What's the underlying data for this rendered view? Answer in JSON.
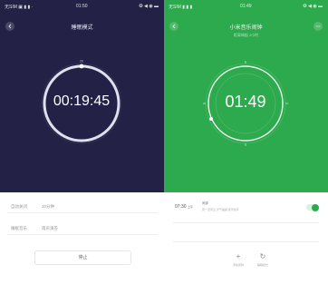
{
  "left": {
    "status": {
      "carrier": "无SIM ▣ ▮ ▮ ·",
      "time": "01:50",
      "icons": "✪ ◀ ◉ ▬"
    },
    "title": "睡眠模式",
    "dial": {
      "time": "00:19:45",
      "tick_label": "20"
    },
    "rows": [
      {
        "label": "自动关闭",
        "value": "20分钟"
      },
      {
        "label": "睡眠音乐",
        "value": "雨声滴答"
      }
    ],
    "stop_label": "停止",
    "colors": {
      "background": "#232146",
      "ring": "#dfe0ee"
    }
  },
  "right": {
    "status": {
      "carrier": "无SIM ▮ ▮ ▮",
      "time": "01:49",
      "icons": "✪ ◀ ◉ ▬"
    },
    "title": "小米音乐闹钟",
    "subtitle": "距离响起 2小时",
    "dial": {
      "time": "01:49"
    },
    "alarm": {
      "time": "07:30",
      "suffix": "上午",
      "label": "闹钟",
      "detail": "周一至周五 天气播报 音乐铃声",
      "enabled": true
    },
    "actions": [
      {
        "glyph": "+",
        "caption": "添加闹钟",
        "icon": "plus-icon"
      },
      {
        "glyph": "↻",
        "caption": "睡眠模式",
        "icon": "refresh-icon"
      }
    ],
    "colors": {
      "background": "#2daa4e",
      "accent": "#2daa4e"
    }
  }
}
